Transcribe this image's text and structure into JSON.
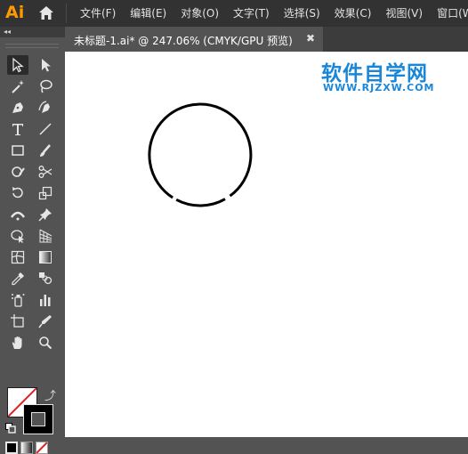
{
  "app": {
    "logo": "Ai"
  },
  "menu": [
    "文件(F)",
    "编辑(E)",
    "对象(O)",
    "文字(T)",
    "选择(S)",
    "效果(C)",
    "视图(V)",
    "窗口(W)"
  ],
  "toolpanel": {
    "collapse_glyph": "◂◂"
  },
  "document": {
    "tab_title": "未标题-1.ai* @ 247.06% (CMYK/GPU 预览)",
    "close_glyph": "✖"
  },
  "watermark": {
    "main": "软件自学网",
    "sub": "WWW.RJZXW.COM"
  },
  "colors": {
    "menubar": "#323232",
    "panel": "#535353",
    "tabbar": "#3c3c3c",
    "canvas": "#ffffff",
    "logo": "#ff9a00",
    "watermark": "#1a86d8",
    "none_slash": "#e02020"
  },
  "tools": [
    "selection-tool",
    "direct-selection-tool",
    "magic-wand-tool",
    "lasso-tool",
    "pen-tool",
    "curvature-tool",
    "type-tool",
    "line-segment-tool",
    "rectangle-tool",
    "paintbrush-tool",
    "shaper-tool",
    "scissors-tool",
    "rotate-tool",
    "scale-tool",
    "width-tool",
    "puppet-warp-tool",
    "shape-builder-tool",
    "perspective-grid-tool",
    "mesh-tool",
    "gradient-tool",
    "eyedropper-tool",
    "blend-tool",
    "symbol-sprayer-tool",
    "column-graph-tool",
    "artboard-tool",
    "slice-tool",
    "hand-tool",
    "zoom-tool"
  ],
  "fill_stroke": {
    "fill": "none",
    "stroke": "#000000"
  }
}
